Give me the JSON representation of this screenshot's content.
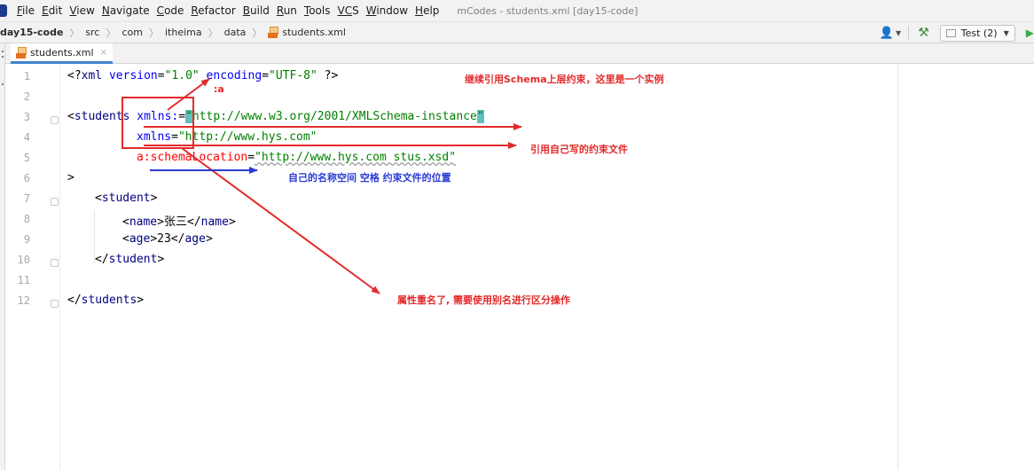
{
  "menu": {
    "items": [
      {
        "mnemonic": "F",
        "rest": "ile"
      },
      {
        "mnemonic": "E",
        "rest": "dit"
      },
      {
        "mnemonic": "V",
        "rest": "iew"
      },
      {
        "mnemonic": "N",
        "rest": "avigate"
      },
      {
        "mnemonic": "C",
        "rest": "ode"
      },
      {
        "mnemonic": "R",
        "rest": "efactor"
      },
      {
        "mnemonic": "B",
        "rest": "uild"
      },
      {
        "mnemonic": "R",
        "rest": "un"
      },
      {
        "mnemonic": "T",
        "rest": "ools"
      },
      {
        "mnemonic": "VC",
        "rest": "S"
      },
      {
        "mnemonic": "W",
        "rest": "indow"
      },
      {
        "mnemonic": "H",
        "rest": "elp"
      }
    ],
    "window_title": "mCodes - students.xml [day15-code]"
  },
  "breadcrumb": {
    "project": "day15-code",
    "parts": [
      "src",
      "com",
      "itheima",
      "data"
    ],
    "file": "students.xml"
  },
  "toolbar": {
    "run_config": "Test (2)"
  },
  "tab": {
    "label": "students.xml",
    "close": "×"
  },
  "editor": {
    "line_numbers": [
      "1",
      "2",
      "3",
      "4",
      "5",
      "6",
      "7",
      "8",
      "9",
      "10",
      "11",
      "12"
    ],
    "line1": {
      "lt": "<?",
      "name": "xml",
      "a1": " version",
      "eq1": "=",
      "v1": "\"1.0\"",
      "a2": " encoding",
      "eq2": "=",
      "v2": "\"UTF-8\"",
      "end": " ?>"
    },
    "line3": {
      "lt": "<",
      "name": "students",
      "attr": " xmlns:",
      "eq": "=",
      "q": "\"",
      "val": "http://www.w3.org/2001/XMLSchema-instance",
      "q2": "\""
    },
    "line4": {
      "attr": "xmlns",
      "eq": "=",
      "val": "\"http://www.hys.com\""
    },
    "line5": {
      "attr": "a:schemaLocation",
      "eq": "=",
      "val": "\"http://www.hys.com stus.xsd\""
    },
    "line6": {
      "text": ">"
    },
    "line7": {
      "lt": "<",
      "name": "student",
      "gt": ">"
    },
    "line8": {
      "lt": "<",
      "name": "name",
      "gt": ">",
      "text": "张三",
      "close_lt": "</",
      "close_name": "name",
      "close_gt": ">"
    },
    "line9": {
      "lt": "<",
      "name": "age",
      "gt": ">",
      "text": "23",
      "close_lt": "</",
      "close_name": "age",
      "close_gt": ">"
    },
    "line10": {
      "lt": "</",
      "name": "student",
      "gt": ">"
    },
    "line12": {
      "lt": "</",
      "name": "students",
      "gt": ">"
    }
  },
  "annotations": {
    "alias_label": ":a",
    "note_schema": "继续引用Schema上层约束，这里是一个实例",
    "note_own_schema": "引用自己写的约束文件",
    "note_namespace": "自己的名称空间  空格  约束文件的位置",
    "note_alias": "属性重名了, 需要使用别名进行区分操作",
    "red_color": "#e32a2a",
    "blue_color": "#2a3bd6"
  }
}
